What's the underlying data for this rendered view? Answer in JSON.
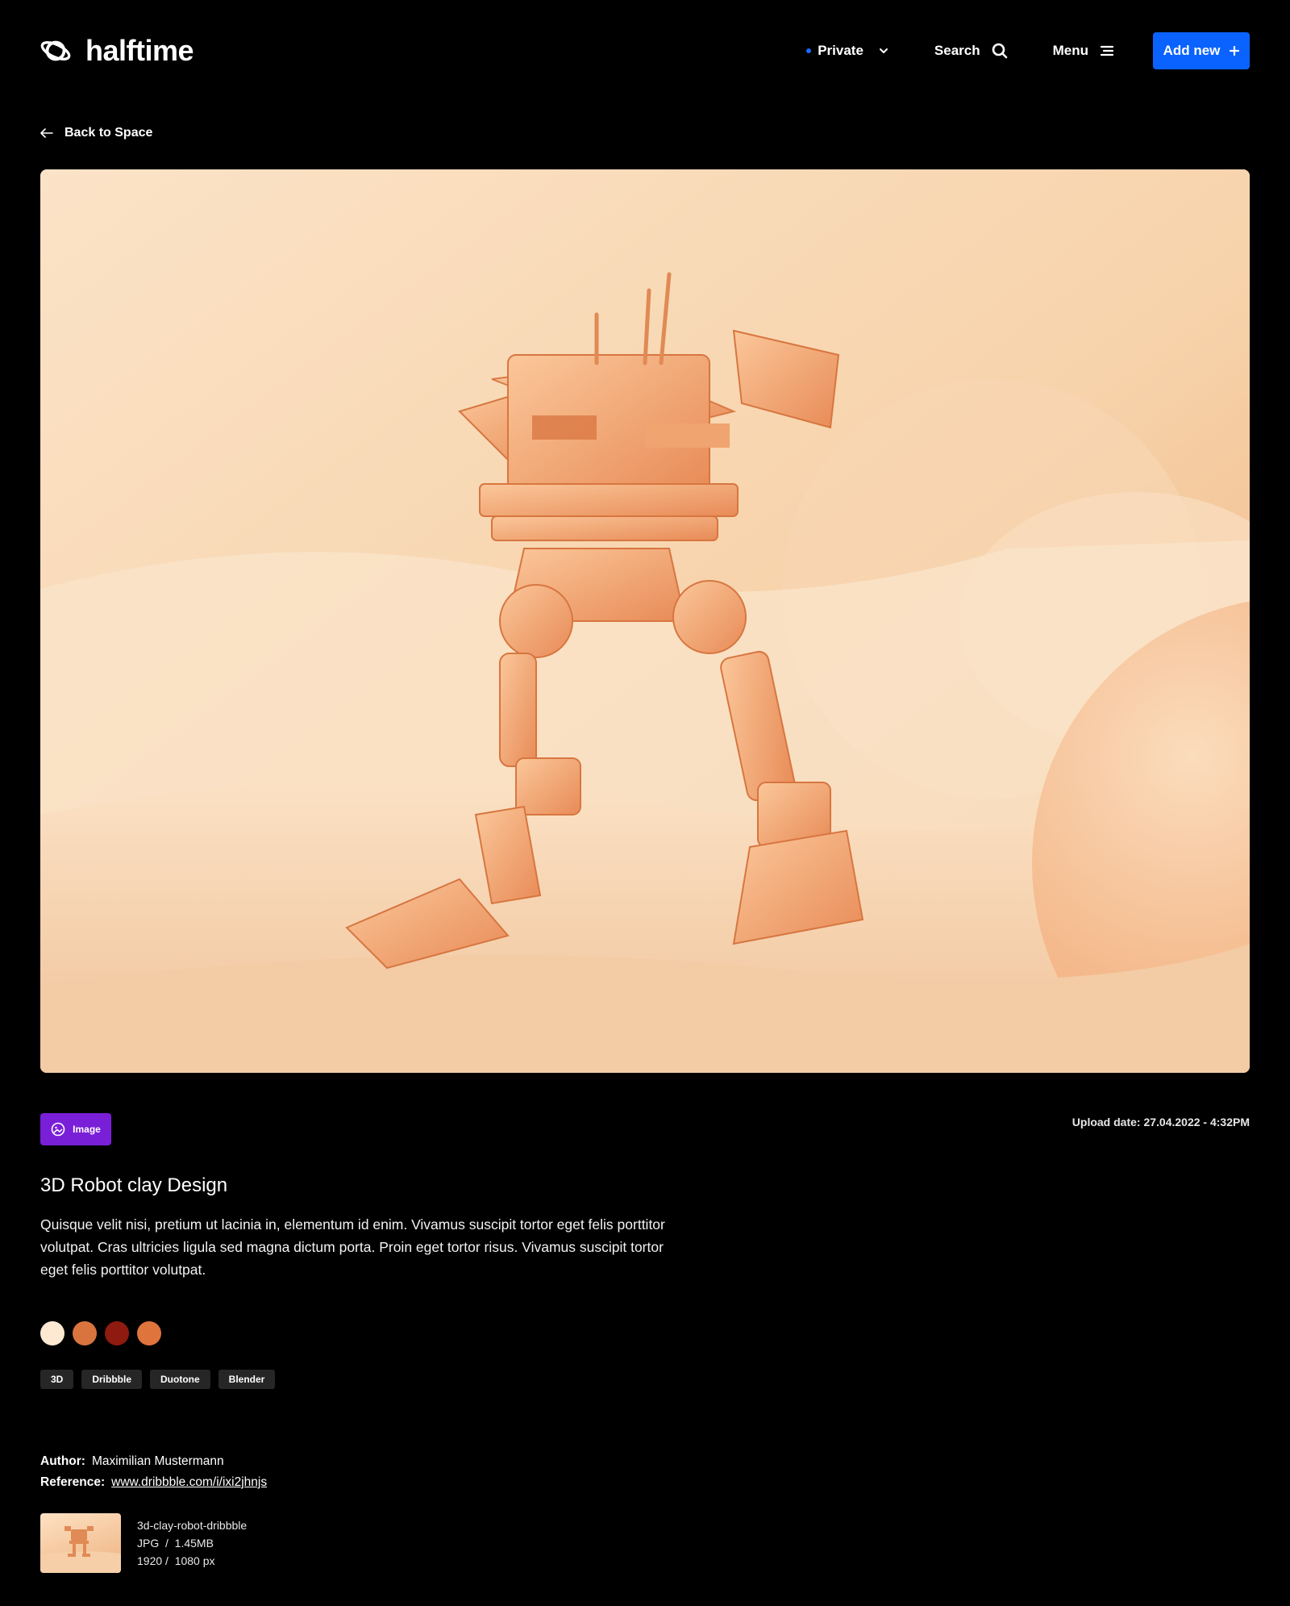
{
  "header": {
    "brand": "halftime",
    "privacy": "Private",
    "search_label": "Search",
    "menu_label": "Menu",
    "add_label": "Add new"
  },
  "back_label": "Back to Space",
  "item": {
    "type_badge": "Image",
    "upload_date": "Upload date: 27.04.2022 - 4:32PM",
    "title": "3D Robot clay Design",
    "description": "Quisque velit nisi, pretium ut lacinia in, elementum id enim. Vivamus suscipit tortor eget felis porttitor volutpat. Cras ultricies ligula sed magna dictum porta. Proin eget tortor risus. Vivamus suscipit tortor eget felis porttitor volutpat.",
    "colors": [
      "#fde9d2",
      "#d9743f",
      "#8e1a10",
      "#e0743d"
    ],
    "tags": [
      "3D",
      "Dribbble",
      "Duotone",
      "Blender"
    ],
    "author_label": "Author:",
    "author": "Maximilian Mustermann",
    "reference_label": "Reference:",
    "reference": "www.dribbble.com/i/ixi2jhnjs"
  },
  "file": {
    "name": "3d-clay-robot-dribbble",
    "format": "JPG  /  1.45MB",
    "dimensions": "1920 /  1080 px"
  },
  "colors": {
    "accent": "#0a63ff",
    "badge": "#7a1fd8",
    "privacy_dot": "#1a6bff"
  }
}
